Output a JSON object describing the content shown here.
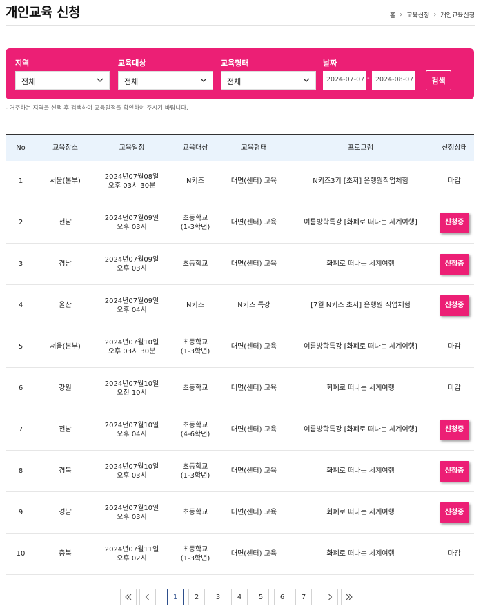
{
  "header": {
    "title": "개인교육 신청",
    "breadcrumb": [
      "홈",
      "교육신청",
      "개인교육신청"
    ]
  },
  "search": {
    "region": {
      "label": "지역",
      "value": "전체"
    },
    "target": {
      "label": "교육대상",
      "value": "전체"
    },
    "type": {
      "label": "교육형태",
      "value": "전체"
    },
    "date": {
      "label": "날짜",
      "from": "2024-07-07",
      "to": "2024-08-07",
      "separator": "-"
    },
    "button": "검색",
    "notice": "- 거주하는 지역을 선택 후 검색하여 교육일정을 확인하여 주시기 바랍니다."
  },
  "table": {
    "headers": [
      "No",
      "교육장소",
      "교육일정",
      "교육대상",
      "교육형태",
      "프로그램",
      "신청상태"
    ],
    "rows": [
      {
        "no": "1",
        "place": "서울(본부)",
        "schedule": "2024년07월08일\n오후 03시 30분",
        "target": "N키즈",
        "type": "대면(센터) 교육",
        "program": "N키즈3기 [초저] 은행원직업체험",
        "status": "마감",
        "open": false
      },
      {
        "no": "2",
        "place": "전남",
        "schedule": "2024년07월09일\n오후 03시",
        "target": "초등학교\n(1-3학년)",
        "type": "대면(센터) 교육",
        "program": "여름방학특강 [화폐로 떠나는 세계여행]",
        "status": "신청중",
        "open": true
      },
      {
        "no": "3",
        "place": "경남",
        "schedule": "2024년07월09일\n오후 03시",
        "target": "초등학교",
        "type": "대면(센터) 교육",
        "program": "화폐로 떠나는 세계여행",
        "status": "신청중",
        "open": true
      },
      {
        "no": "4",
        "place": "울산",
        "schedule": "2024년07월09일\n오후 04시",
        "target": "N키즈",
        "type": "N키즈 특강",
        "program": "[7월 N키즈 초저] 은행원 직업체험",
        "status": "신청중",
        "open": true
      },
      {
        "no": "5",
        "place": "서울(본부)",
        "schedule": "2024년07월10일\n오후 03시 30분",
        "target": "초등학교\n(1-3학년)",
        "type": "대면(센터) 교육",
        "program": "여름방학특강 [화폐로 떠나는 세계여행]",
        "status": "마감",
        "open": false
      },
      {
        "no": "6",
        "place": "강원",
        "schedule": "2024년07월10일\n오전 10시",
        "target": "초등학교",
        "type": "대면(센터) 교육",
        "program": "화폐로 떠나는 세계여행",
        "status": "마감",
        "open": false
      },
      {
        "no": "7",
        "place": "전남",
        "schedule": "2024년07월10일\n오후 04시",
        "target": "초등학교\n(4-6학년)",
        "type": "대면(센터) 교육",
        "program": "여름방학특강 [화폐로 떠나는 세계여행]",
        "status": "신청중",
        "open": true
      },
      {
        "no": "8",
        "place": "경북",
        "schedule": "2024년07월10일\n오후 03시",
        "target": "초등학교\n(1-3학년)",
        "type": "대면(센터) 교육",
        "program": "화폐로 떠나는 세계여행",
        "status": "신청중",
        "open": true
      },
      {
        "no": "9",
        "place": "경남",
        "schedule": "2024년07월10일\n오후 03시",
        "target": "초등학교",
        "type": "대면(센터) 교육",
        "program": "화폐로 떠나는 세계여행",
        "status": "신청중",
        "open": true
      },
      {
        "no": "10",
        "place": "충북",
        "schedule": "2024년07월11일\n오후 02시",
        "target": "초등학교\n(1-3학년)",
        "type": "대면(센터) 교육",
        "program": "화폐로 떠나는 세계여행",
        "status": "마감",
        "open": false
      }
    ]
  },
  "pagination": {
    "pages": [
      "1",
      "2",
      "3",
      "4",
      "5",
      "6",
      "7"
    ],
    "current": "1"
  },
  "colors": {
    "accent": "#ec1f75",
    "header_bg": "#eaf3fc",
    "active_page": "#2d4e8b"
  }
}
